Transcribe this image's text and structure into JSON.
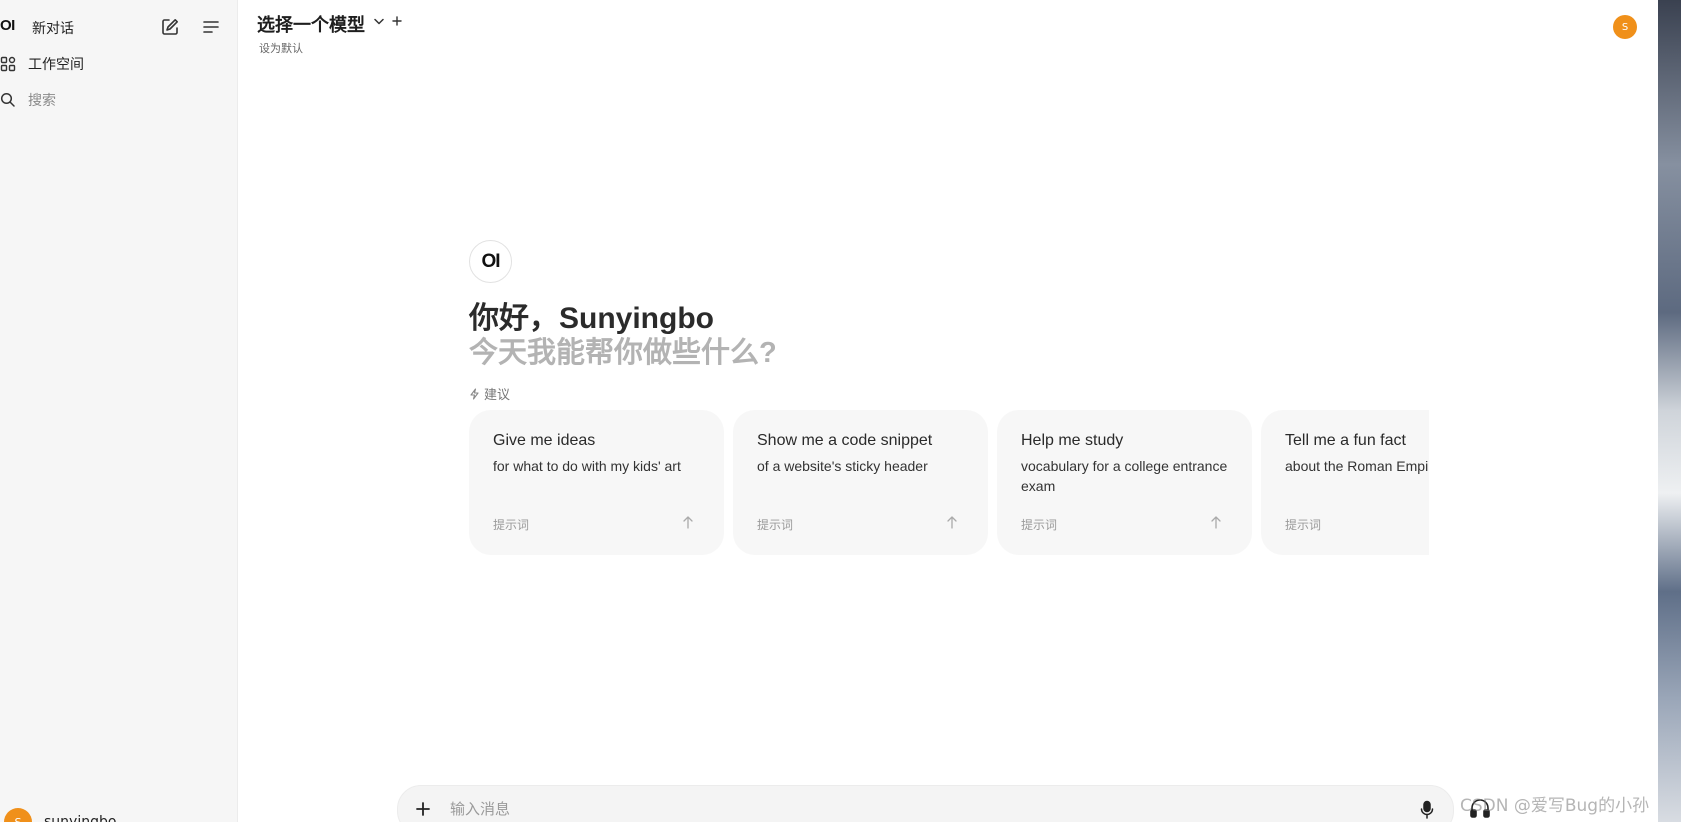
{
  "sidebar": {
    "brand_logo": "OI",
    "new_chat": "新对话",
    "items": [
      {
        "label": "工作空间",
        "icon": "workspace-icon"
      },
      {
        "label": "搜索",
        "icon": "search-icon"
      }
    ],
    "user": {
      "avatar_letter": "S",
      "name": "sunyingbo"
    }
  },
  "header": {
    "model_select": "选择一个模型",
    "set_default": "设为默认",
    "avatar_letter": "S"
  },
  "welcome": {
    "logo": "OI",
    "greeting": "你好，Sunyingbo",
    "subtitle": "今天我能帮你做些什么?",
    "suggestions_label": "建议"
  },
  "suggestions": [
    {
      "title": "Give me ideas",
      "subtitle": "for what to do with my kids' art",
      "tag": "提示词"
    },
    {
      "title": "Show me a code snippet",
      "subtitle": "of a website's sticky header",
      "tag": "提示词"
    },
    {
      "title": "Help me study",
      "subtitle": "vocabulary for a college entrance exam",
      "tag": "提示词"
    },
    {
      "title": "Tell me a fun fact",
      "subtitle": "about the Roman Empire",
      "tag": "提示词"
    }
  ],
  "composer": {
    "placeholder": "输入消息"
  },
  "watermark": "CSDN @爱写Bug的小孙",
  "colors": {
    "avatar": "#f0901a",
    "sidebar_bg": "#f6f6f6",
    "card_bg": "#f7f7f7"
  }
}
